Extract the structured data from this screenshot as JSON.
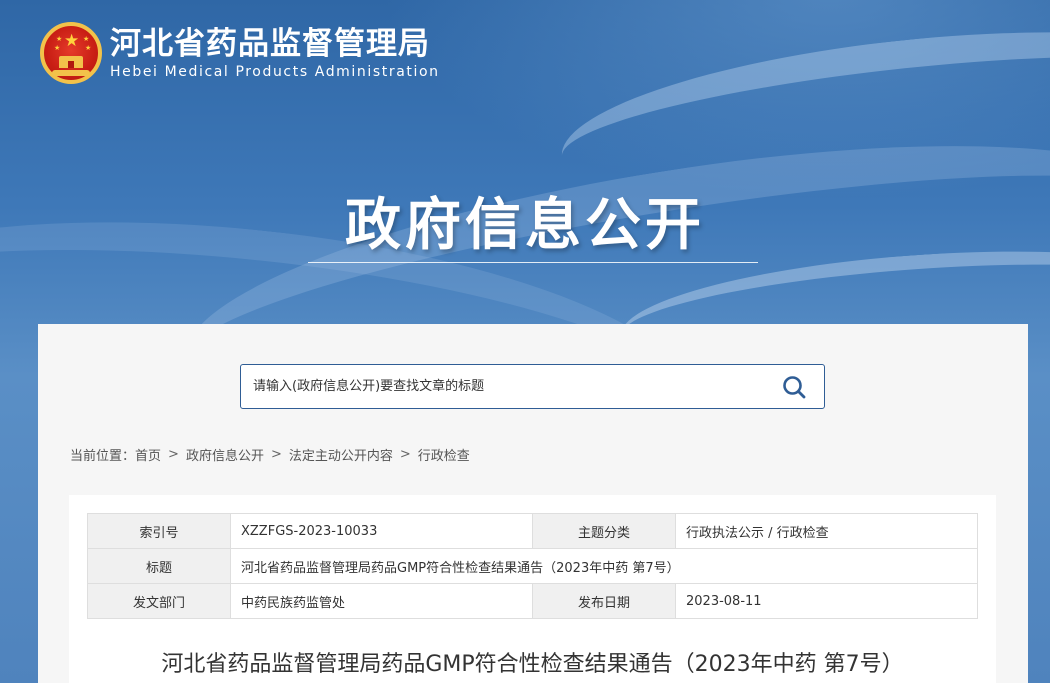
{
  "header": {
    "org_name_cn": "河北省药品监督管理局",
    "org_name_en": "Hebei Medical Products Administration",
    "emblem_icon": "national-emblem-icon"
  },
  "hero": {
    "title": "政府信息公开"
  },
  "search": {
    "placeholder": "请输入(政府信息公开)要查找文章的标题",
    "button_icon": "search-icon"
  },
  "breadcrumb": {
    "label": "当前位置：",
    "items": [
      "首页",
      "政府信息公开",
      "法定主动公开内容",
      "行政检查"
    ],
    "separator": ">"
  },
  "meta": {
    "index_label": "索引号",
    "index_value": "XZZFGS-2023-10033",
    "topic_label": "主题分类",
    "topic_value": "行政执法公示 / 行政检查",
    "title_label": "标题",
    "title_value": "河北省药品监督管理局药品GMP符合性检查结果通告（2023年中药 第7号）",
    "dept_label": "发文部门",
    "dept_value": "中药民族药监管处",
    "date_label": "发布日期",
    "date_value": "2023-08-11"
  },
  "document": {
    "title": "河北省药品监督管理局药品GMP符合性检查结果通告（2023年中药 第7号）"
  },
  "colors": {
    "banner": "#3f72ad",
    "search_border": "#2f5d95",
    "icon": "#2f5d95",
    "panel": "#f6f6f6",
    "label_bg": "#f0f0f0"
  }
}
